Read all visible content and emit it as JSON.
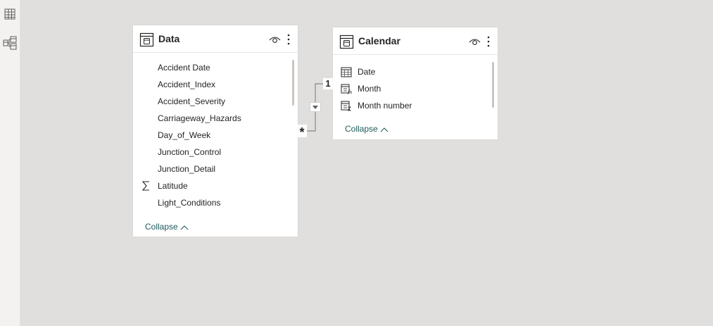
{
  "left_rail": {
    "items": [
      {
        "icon": "table-view-icon"
      },
      {
        "icon": "model-view-icon"
      }
    ]
  },
  "tables": {
    "data": {
      "title": "Data",
      "fields": [
        {
          "label": "Accident Date",
          "icon": ""
        },
        {
          "label": "Accident_Index",
          "icon": ""
        },
        {
          "label": "Accident_Severity",
          "icon": ""
        },
        {
          "label": "Carriageway_Hazards",
          "icon": ""
        },
        {
          "label": "Day_of_Week",
          "icon": ""
        },
        {
          "label": "Junction_Control",
          "icon": ""
        },
        {
          "label": "Junction_Detail",
          "icon": ""
        },
        {
          "label": "Latitude",
          "icon": "sigma-icon"
        },
        {
          "label": "Light_Conditions",
          "icon": ""
        }
      ],
      "collapse_label": "Collapse"
    },
    "calendar": {
      "title": "Calendar",
      "fields": [
        {
          "label": "Date",
          "icon": "calendar-icon"
        },
        {
          "label": "Month",
          "icon": "calculated-column-icon"
        },
        {
          "label": "Month number",
          "icon": "calculated-column-icon"
        }
      ],
      "collapse_label": "Collapse"
    }
  },
  "relationship": {
    "one_side": "1",
    "many_side": "*"
  },
  "colors": {
    "canvas": "#e1dfdd",
    "rail": "#f3f2f1",
    "card": "#ffffff",
    "collapse_link": "#1f5b5b",
    "text": "#252423"
  }
}
